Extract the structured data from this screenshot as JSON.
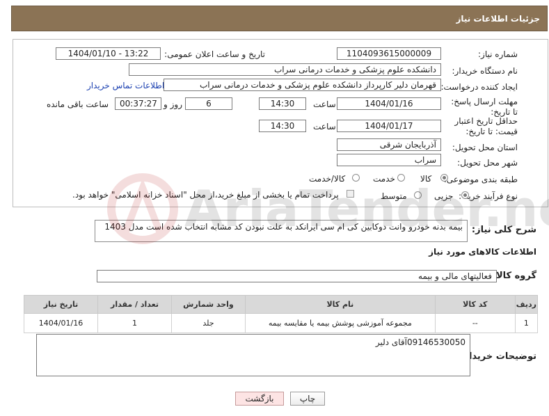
{
  "header": {
    "title": "جزئیات اطلاعات نیاز"
  },
  "form": {
    "need_number_label": "شماره نیاز:",
    "need_number": "1104093615000009",
    "announce_label": "تاریخ و ساعت اعلان عمومی:",
    "announce_value": "1404/01/10 - 13:22",
    "buyer_org_label": "نام دستگاه خریدار:",
    "buyer_org": "دانشکده علوم پزشکی و خدمات درمانی سراب",
    "creator_label": "ایجاد کننده درخواست:",
    "creator": "قهرمان دلیر کارپرداز دانشکده علوم پزشکی و خدمات درمانی سراب",
    "contact_link": "اطلاعات تماس خریدار",
    "deadline_label": "مهلت ارسال پاسخ: تا تاریخ:",
    "deadline_date": "1404/01/16",
    "time_label": "ساعت",
    "deadline_time": "14:30",
    "days": "6",
    "days_and_label": "روز و",
    "remaining_time": "00:37:27",
    "remaining_label": "ساعت باقی مانده",
    "validity_label": "حداقل تاریخ اعتبار قیمت: تا تاریخ:",
    "validity_date": "1404/01/17",
    "validity_time": "14:30",
    "province_label": "استان محل تحویل:",
    "province": "آذربایجان شرقی",
    "city_label": "شهر محل تحویل:",
    "city": "سراب",
    "category_label": "طبقه بندی موضوعی:",
    "category_options": [
      "کالا",
      "خدمت",
      "کالا/خدمت"
    ],
    "purchase_type_label": "نوع فرآیند خرید :",
    "purchase_options": [
      "جزیی",
      "متوسط"
    ],
    "payment_note": "پرداخت تمام یا بخشی از مبلغ خرید،از محل \"اسناد خزانه اسلامی\" خواهد بود."
  },
  "description": {
    "label": "شرح کلی نیاز:",
    "text": "بیمه بدنه خودرو وانت دوکابین کی ام سی ایرانکد به علت نبودن کد مشابه انتخاب شده است مدل 1403"
  },
  "goods": {
    "section_title": "اطلاعات کالاهای مورد نیاز",
    "group_label": "گروه کالا:",
    "group_value": "فعالیتهای مالی و بیمه",
    "columns": [
      "ردیف",
      "کد کالا",
      "نام کالا",
      "واحد شمارش",
      "تعداد / مقدار",
      "تاریخ نیاز"
    ],
    "rows": [
      [
        "1",
        "--",
        "مجموعه آموزشی پوشش بیمه یا مقایسه بیمه",
        "جلد",
        "1",
        "1404/01/16"
      ]
    ]
  },
  "buyer_notes": {
    "label": "توضیحات خریدار:",
    "text": "09146530050آقای دلیر"
  },
  "buttons": {
    "print": "چاپ",
    "back": "بازگشت"
  },
  "watermark": {
    "text": "AriaTender.net"
  }
}
